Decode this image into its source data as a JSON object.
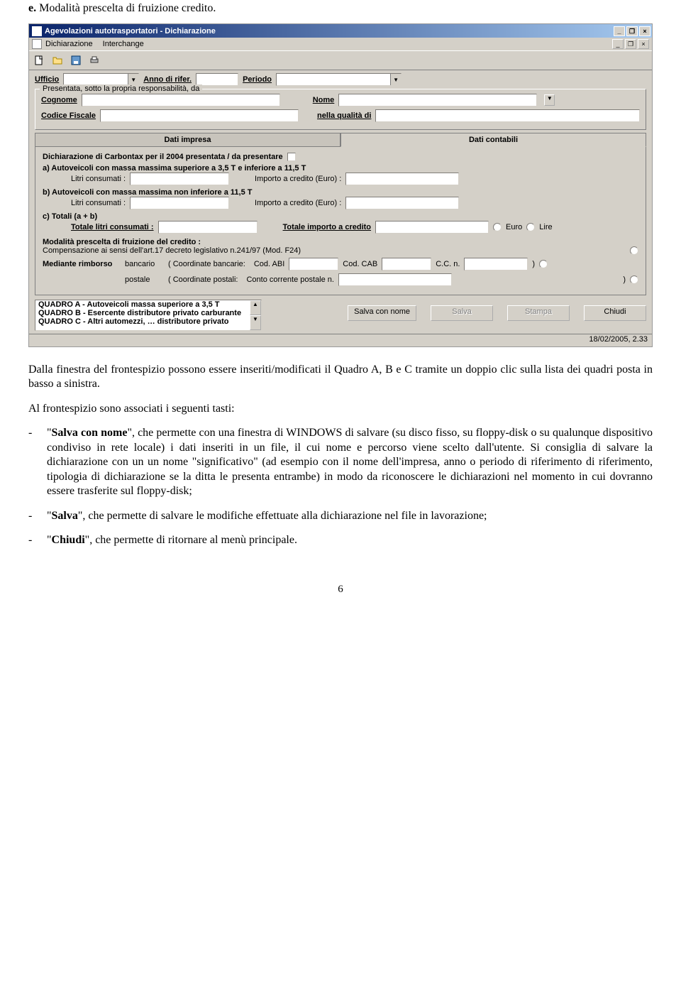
{
  "heading": {
    "label": "e.",
    "text": "Modalità prescelta di fruizione credito."
  },
  "titlebar": {
    "title": "Agevolazioni autotrasportatori - Dichiarazione"
  },
  "menubar": {
    "dichiarazione": "Dichiarazione",
    "interchange": "Interchange"
  },
  "toprow": {
    "ufficio": "Ufficio",
    "anno": "Anno di rifer.",
    "periodo": "Periodo"
  },
  "presentata": {
    "legend": "Presentata, sotto la propria responsabilità, da",
    "cognome": "Cognome",
    "nome": "Nome",
    "cf": "Codice Fiscale",
    "qualita": "nella qualità di"
  },
  "tabs": {
    "impresa": "Dati impresa",
    "contabili": "Dati contabili"
  },
  "tabpane": {
    "carbontax": "Dichiarazione di Carbontax per il 2004 presentata / da presentare",
    "a_title": "a) Autoveicoli con massa massima superiore a 3,5 T e inferiore a 11,5 T",
    "b_title": "b) Autoveicoli con massa massima non inferiore a 11,5 T",
    "litri": "Litri consumati :",
    "importo": "Importo a credito (Euro) :",
    "c_title": "c) Totali (a + b)",
    "totlitri": "Totale litri consumati :",
    "totimporto": "Totale importo a credito",
    "euro": "Euro",
    "lire": "Lire",
    "modalita": "Modalità prescelta di fruizione del credito :",
    "compensazione": "Compensazione ai sensi dell'art.17 decreto legislativo n.241/97 (Mod. F24)",
    "mediante": "Mediante rimborso",
    "bancario": "bancario",
    "postale": "postale",
    "coordb": "( Coordinate bancarie:",
    "codabi": "Cod. ABI",
    "codcab": "Cod. CAB",
    "ccn": "C.C. n.",
    "coordp": "( Coordinate postali:",
    "ccp": "Conto corrente postale n.",
    "paren_close": ")"
  },
  "quadri": {
    "a": "QUADRO A - Autoveicoli massa superiore a 3,5 T",
    "b": "QUADRO B - Esercente distributore privato carburante",
    "c": "QUADRO C - Altri automezzi, … distributore privato"
  },
  "buttons": {
    "salvacon": "Salva con nome",
    "salva": "Salva",
    "stampa": "Stampa",
    "chiudi": "Chiudi"
  },
  "statusbar": "18/02/2005, 2.33",
  "bodytext": {
    "intro": "Dalla finestra del frontespizio possono essere inseriti/modificati il Quadro A, B e C tramite un doppio clic sulla lista dei quadri posta in basso a sinistra.",
    "lead": "Al frontespizio sono associati i seguenti tasti:",
    "b1": "\", che permette con una finestra di WINDOWS di salvare (su disco fisso, su floppy-disk o su qualunque dispositivo condiviso in rete locale) i dati inseriti in un file, il cui nome e percorso viene scelto dall'utente. Si consiglia di salvare la dichiarazione con un un nome \"significativo\" (ad esempio con il nome dell'impresa, anno o periodo di riferimento di riferimento, tipologia di dichiarazione se la ditta le presenta entrambe) in modo da riconoscere le dichiarazioni nel momento in cui dovranno essere trasferite sul floppy-disk;",
    "b1_name": "Salva con nome",
    "b2_name": "Salva",
    "b2": "\", che permette di salvare le modifiche effettuate alla dichiarazione nel file in lavorazione;",
    "b3_name": "Chiudi",
    "b3": "\", che permette di ritornare al menù principale."
  },
  "pagenum": "6"
}
